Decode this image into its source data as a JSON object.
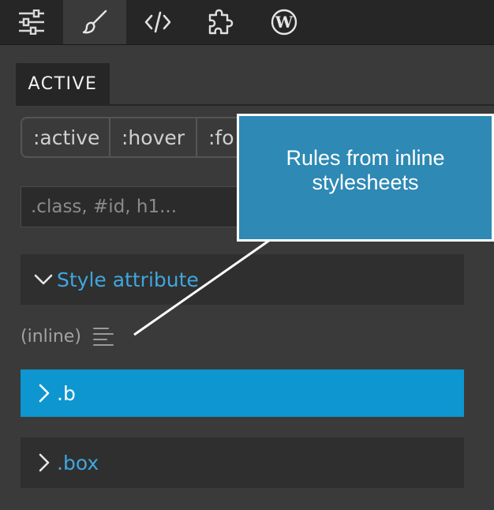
{
  "toolbar": {
    "items": [
      {
        "name": "sliders-icon",
        "active": false
      },
      {
        "name": "paintbrush-icon",
        "active": true
      },
      {
        "name": "code-icon",
        "active": false
      },
      {
        "name": "puzzle-icon",
        "active": false
      },
      {
        "name": "wordpress-icon",
        "active": false
      }
    ]
  },
  "state_tab": {
    "label": "ACTIVE"
  },
  "pseudo_states": [
    ":active",
    ":hover",
    ":fo"
  ],
  "selector": {
    "placeholder": ".class, #id, h1..."
  },
  "rules": {
    "style_attribute": "Style attribute",
    "inline_label": "(inline)",
    "b": ".b",
    "box": ".box"
  },
  "callout": {
    "text": "Rules from inline stylesheets"
  },
  "colors": {
    "accent": "#0d96cf",
    "link": "#3fa7de",
    "panel": "#3a3a3a",
    "dark": "#262626",
    "callout": "#2e89b4"
  }
}
